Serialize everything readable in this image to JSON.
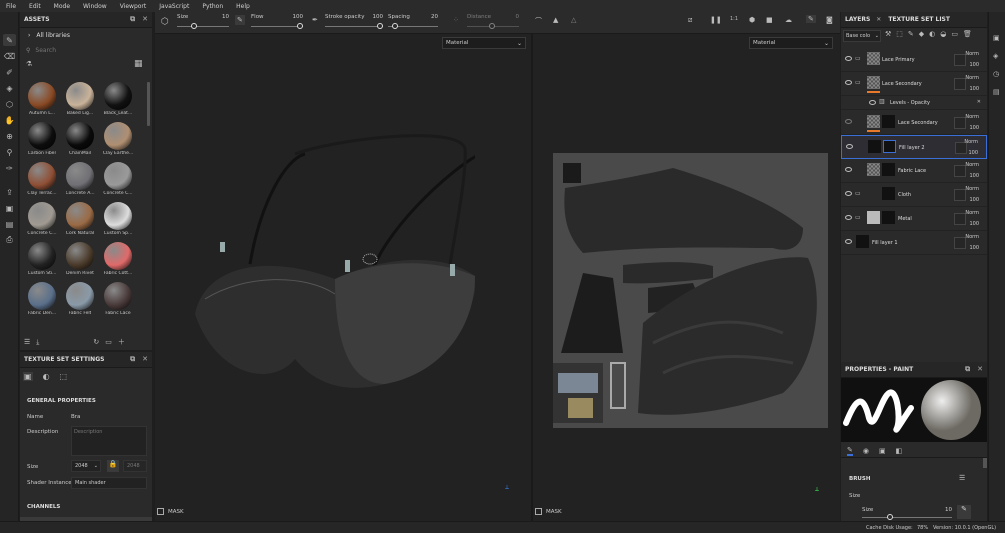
{
  "menu": [
    "File",
    "Edit",
    "Mode",
    "Window",
    "Viewport",
    "JavaScript",
    "Python",
    "Help"
  ],
  "assets": {
    "title": "ASSETS",
    "library": "All libraries",
    "search_placeholder": "Search",
    "items": [
      {
        "label": "Autumn L...",
        "color": "#8a4a25"
      },
      {
        "label": "Baked Lig...",
        "color": "#c9b39a"
      },
      {
        "label": "Black_Leat...",
        "color": "#111111"
      },
      {
        "label": "Carbon Fiber",
        "color": "#0d0d0d"
      },
      {
        "label": "ChainMail",
        "color": "#0a0a0a"
      },
      {
        "label": "Clay Earthe...",
        "color": "#b08f72"
      },
      {
        "label": "Clay Terrac...",
        "color": "#8f4f35"
      },
      {
        "label": "Concrete A...",
        "color": "#707075"
      },
      {
        "label": "Concrete C...",
        "color": "#9a9a9a"
      },
      {
        "label": "Concrete C...",
        "color": "#a09a92"
      },
      {
        "label": "Cork Natural",
        "color": "#9a6a45"
      },
      {
        "label": "Custom Sp...",
        "color": "#dddddd"
      },
      {
        "label": "Custom Sti...",
        "color": "#222222"
      },
      {
        "label": "Denim Rivet",
        "color": "#4a3a2a"
      },
      {
        "label": "Fabric Cott...",
        "color": "#e06a6a"
      },
      {
        "label": "Fabric Den...",
        "color": "#5a6f8a"
      },
      {
        "label": "Fabric Felt",
        "color": "#8a9aa8"
      },
      {
        "label": "Fabric Lace",
        "color": "#4a3a3a"
      }
    ]
  },
  "texture_set_settings": {
    "title": "TEXTURE SET SETTINGS",
    "section": "GENERAL PROPERTIES",
    "name_label": "Name",
    "name_value": "Bra",
    "description_label": "Description",
    "description_placeholder": "Description",
    "size_label": "Size",
    "size_value": "2048",
    "size_linked": "2048",
    "shader_label": "Shader Instance",
    "shader_value": "Main shader",
    "channels": "CHANNELS"
  },
  "toolbar": {
    "size_label": "Size",
    "size_value": "10",
    "flow_label": "Flow",
    "flow_value": "100",
    "stroke_label": "Stroke opacity",
    "stroke_value": "100",
    "spacing_label": "Spacing",
    "spacing_value": "20",
    "distance_label": "Distance",
    "distance_value": "0"
  },
  "viewport": {
    "material_left": "Material",
    "material_right": "Material",
    "mask_left": "MASK",
    "mask_right": "MASK"
  },
  "layers": {
    "tab_layers": "LAYERS",
    "tab_texture": "TEXTURE SET LIST",
    "channel": "Base colo",
    "rows": [
      {
        "name": "Lace Primary",
        "blend": "Norm",
        "opacity": "100"
      },
      {
        "name": "Lace Secondary",
        "blend": "Norm",
        "opacity": "100"
      },
      {
        "name": "Levels - Opacity",
        "blend": "",
        "opacity": ""
      },
      {
        "name": "Lace Secondary",
        "blend": "Norm",
        "opacity": "100"
      },
      {
        "name": "Fill layer 2",
        "blend": "Norm",
        "opacity": "100"
      },
      {
        "name": "Fabric Lace",
        "blend": "Norm",
        "opacity": "100"
      },
      {
        "name": "Cloth",
        "blend": "Norm",
        "opacity": "100"
      },
      {
        "name": "Metal",
        "blend": "Norm",
        "opacity": "100"
      },
      {
        "name": "Fill layer 1",
        "blend": "Norm",
        "opacity": "100"
      }
    ]
  },
  "properties": {
    "title": "PROPERTIES - PAINT",
    "brush": "BRUSH",
    "size_label": "Size",
    "size_sub": "Size",
    "size_value": "10"
  },
  "status": {
    "cache": "Cache Disk Usage:",
    "cache_value": "78%",
    "version": "Version: 10.0.1 (OpenGL)"
  }
}
